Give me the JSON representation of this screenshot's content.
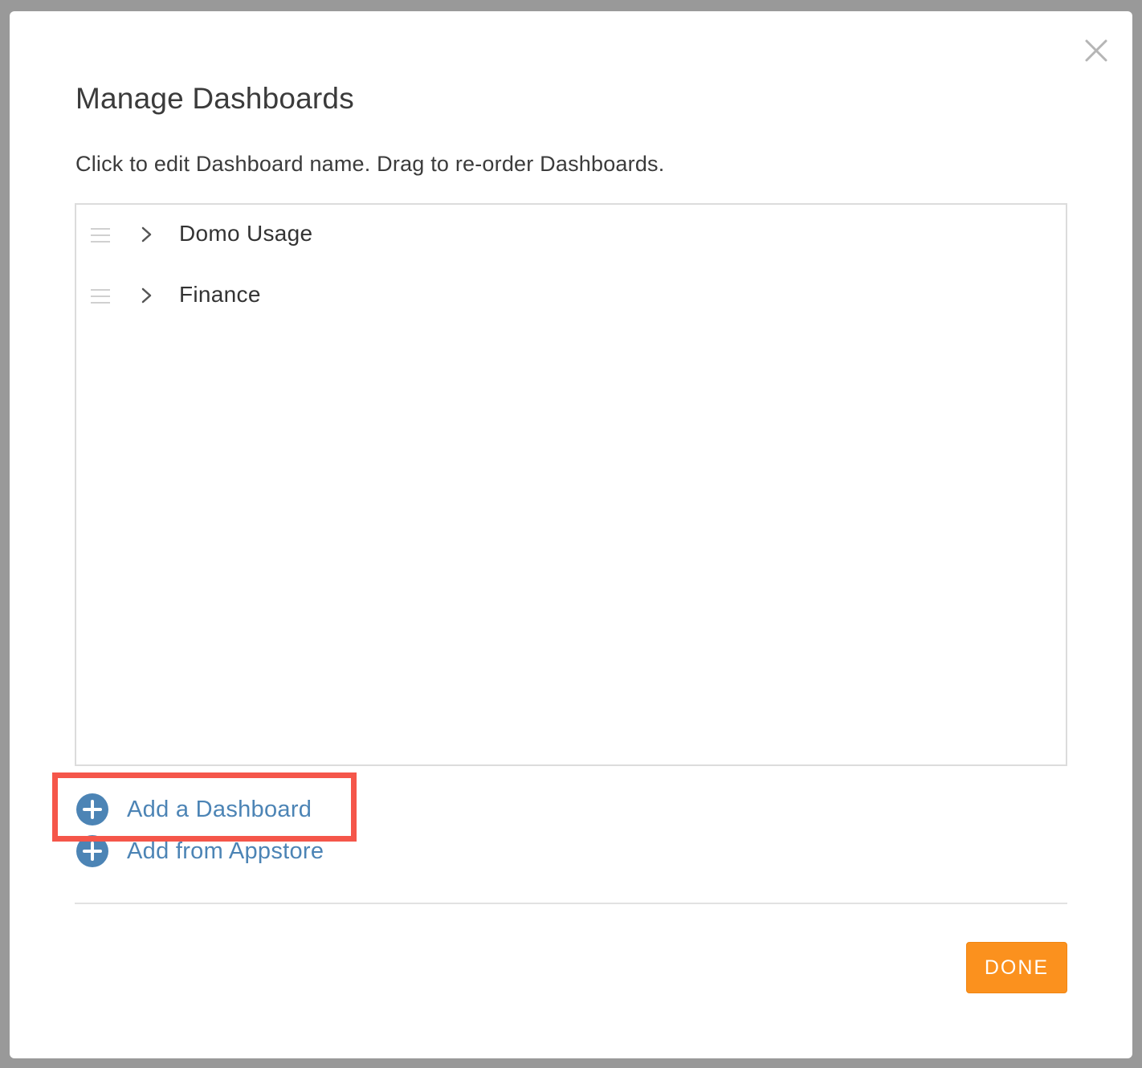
{
  "dialog": {
    "title": "Manage Dashboards",
    "instructions": "Click to edit Dashboard name. Drag to re-order Dashboards.",
    "close_icon": "close-icon"
  },
  "dashboards": [
    {
      "label": "Domo Usage",
      "icons": [
        "drag-handle-icon",
        "chevron-right-icon"
      ]
    },
    {
      "label": "Finance",
      "icons": [
        "drag-handle-icon",
        "chevron-right-icon"
      ]
    }
  ],
  "actions": {
    "add_dashboard": {
      "label": "Add a Dashboard",
      "icon": "plus-circle-icon"
    },
    "add_from_appstore": {
      "label": "Add from Appstore",
      "icon": "plus-circle-icon"
    }
  },
  "footer": {
    "done_label": "DONE"
  },
  "colors": {
    "accent_blue": "#4c84b5",
    "done_orange": "#fb911e",
    "highlight_red": "#f5564a",
    "backdrop": "#999999"
  }
}
